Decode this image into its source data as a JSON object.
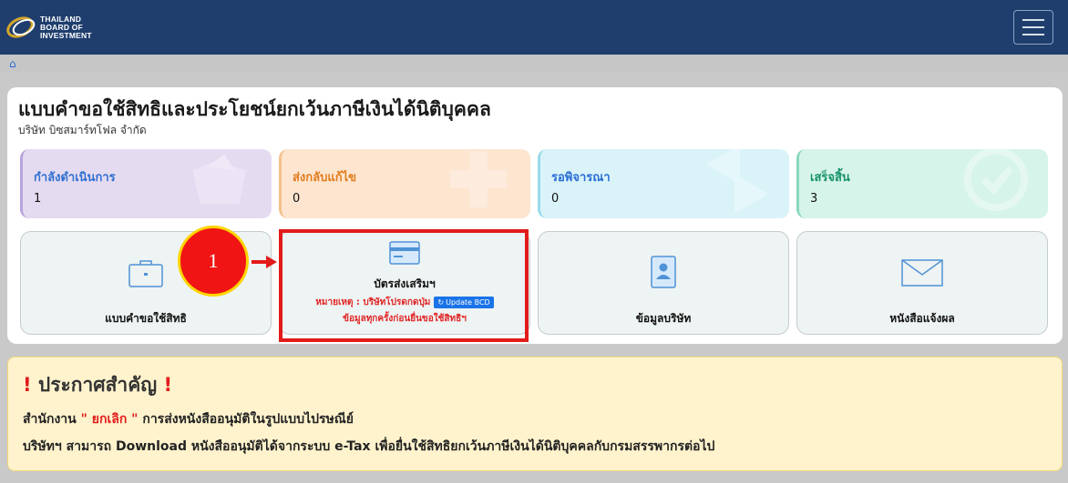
{
  "header": {
    "logo_lines": [
      "THAILAND",
      "BOARD OF",
      "INVESTMENT"
    ],
    "menu_icon": "hamburger-icon"
  },
  "breadcrumb": {
    "home_icon": "home-icon"
  },
  "page": {
    "title": "แบบคำขอใช้สิทธิและประโยชน์ยกเว้นภาษีเงินได้นิติบุคคล",
    "company": "บริษัท บิซสมาร์ทโฟล จำกัด"
  },
  "stats": [
    {
      "label": "กำลังดำเนินการ",
      "value": "1",
      "color": "#2f6fd0",
      "icon": "folder-icon"
    },
    {
      "label": "ส่งกลับแก้ไข",
      "value": "0",
      "color": "#e07d1e",
      "icon": "plus-icon"
    },
    {
      "label": "รอพิจารณา",
      "value": "0",
      "color": "#2a6dd6",
      "icon": "hourglass-icon"
    },
    {
      "label": "เสร็จสิ้น",
      "value": "3",
      "color": "#15906a",
      "icon": "check-icon"
    }
  ],
  "cards": {
    "request": {
      "label": "แบบคำขอใช้สิทธิ",
      "icon": "briefcase-icon"
    },
    "bcd": {
      "label": "บัตรส่งเสริมฯ",
      "icon": "card-icon",
      "note_prefix": "หมายเหตุ : บริษัทโปรดกดปุ่ม",
      "update_button": "Update BCD",
      "note_suffix": "ข้อมูลทุกครั้งก่อนยื่นขอใช้สิทธิฯ"
    },
    "company_info": {
      "label": "ข้อมูลบริษัท",
      "icon": "contact-book-icon"
    },
    "letters": {
      "label": "หนังสือแจ้งผล",
      "icon": "envelope-icon"
    }
  },
  "callout": {
    "number": "1"
  },
  "announcement": {
    "title_mark": "!",
    "title": "ประกาศสำคัญ",
    "line1_prefix": "สำนักงาน",
    "line1_highlight": "\" ยกเลิก \"",
    "line1_suffix": "การส่งหนังสืออนุมัติในรูปแบบไปรษณีย์",
    "line2": "บริษัทฯ สามารถ Download หนังสืออนุมัติได้จากระบบ e-Tax เพื่อยื่นใช้สิทธิยกเว้นภาษีเงินได้นิติบุคคลกับกรมสรรพากรต่อไป"
  }
}
